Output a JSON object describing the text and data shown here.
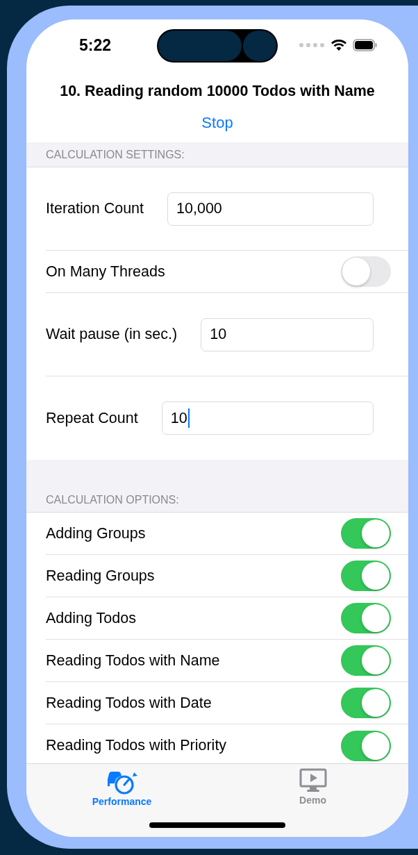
{
  "status_bar": {
    "time": "5:22"
  },
  "header": {
    "title": "10. Reading random 10000 Todos with Name",
    "action": "Stop"
  },
  "settings": {
    "heading": "CALCULATION SETTINGS:",
    "rows": [
      {
        "kind": "field",
        "label": "Iteration Count",
        "value": "10,000",
        "focused": false
      },
      {
        "kind": "toggle",
        "label": "On Many Threads",
        "on": false
      },
      {
        "kind": "field",
        "label": "Wait pause (in sec.)",
        "value": "10",
        "focused": false
      },
      {
        "kind": "field",
        "label": "Repeat Count",
        "value": "10",
        "focused": true
      }
    ]
  },
  "options": {
    "heading": "CALCULATION OPTIONS:",
    "rows": [
      {
        "kind": "toggle",
        "label": "Adding Groups",
        "on": true
      },
      {
        "kind": "toggle",
        "label": "Reading Groups",
        "on": true
      },
      {
        "kind": "toggle",
        "label": "Adding Todos",
        "on": true
      },
      {
        "kind": "toggle",
        "label": "Reading Todos with Name",
        "on": true
      },
      {
        "kind": "toggle",
        "label": "Reading Todos with Date",
        "on": true
      },
      {
        "kind": "toggle",
        "label": "Reading Todos with Priority",
        "on": true
      }
    ]
  },
  "tabs": [
    {
      "label": "Performance",
      "kind": "gauge",
      "selected": true
    },
    {
      "label": "Demo",
      "kind": "monitor",
      "selected": false
    }
  ]
}
